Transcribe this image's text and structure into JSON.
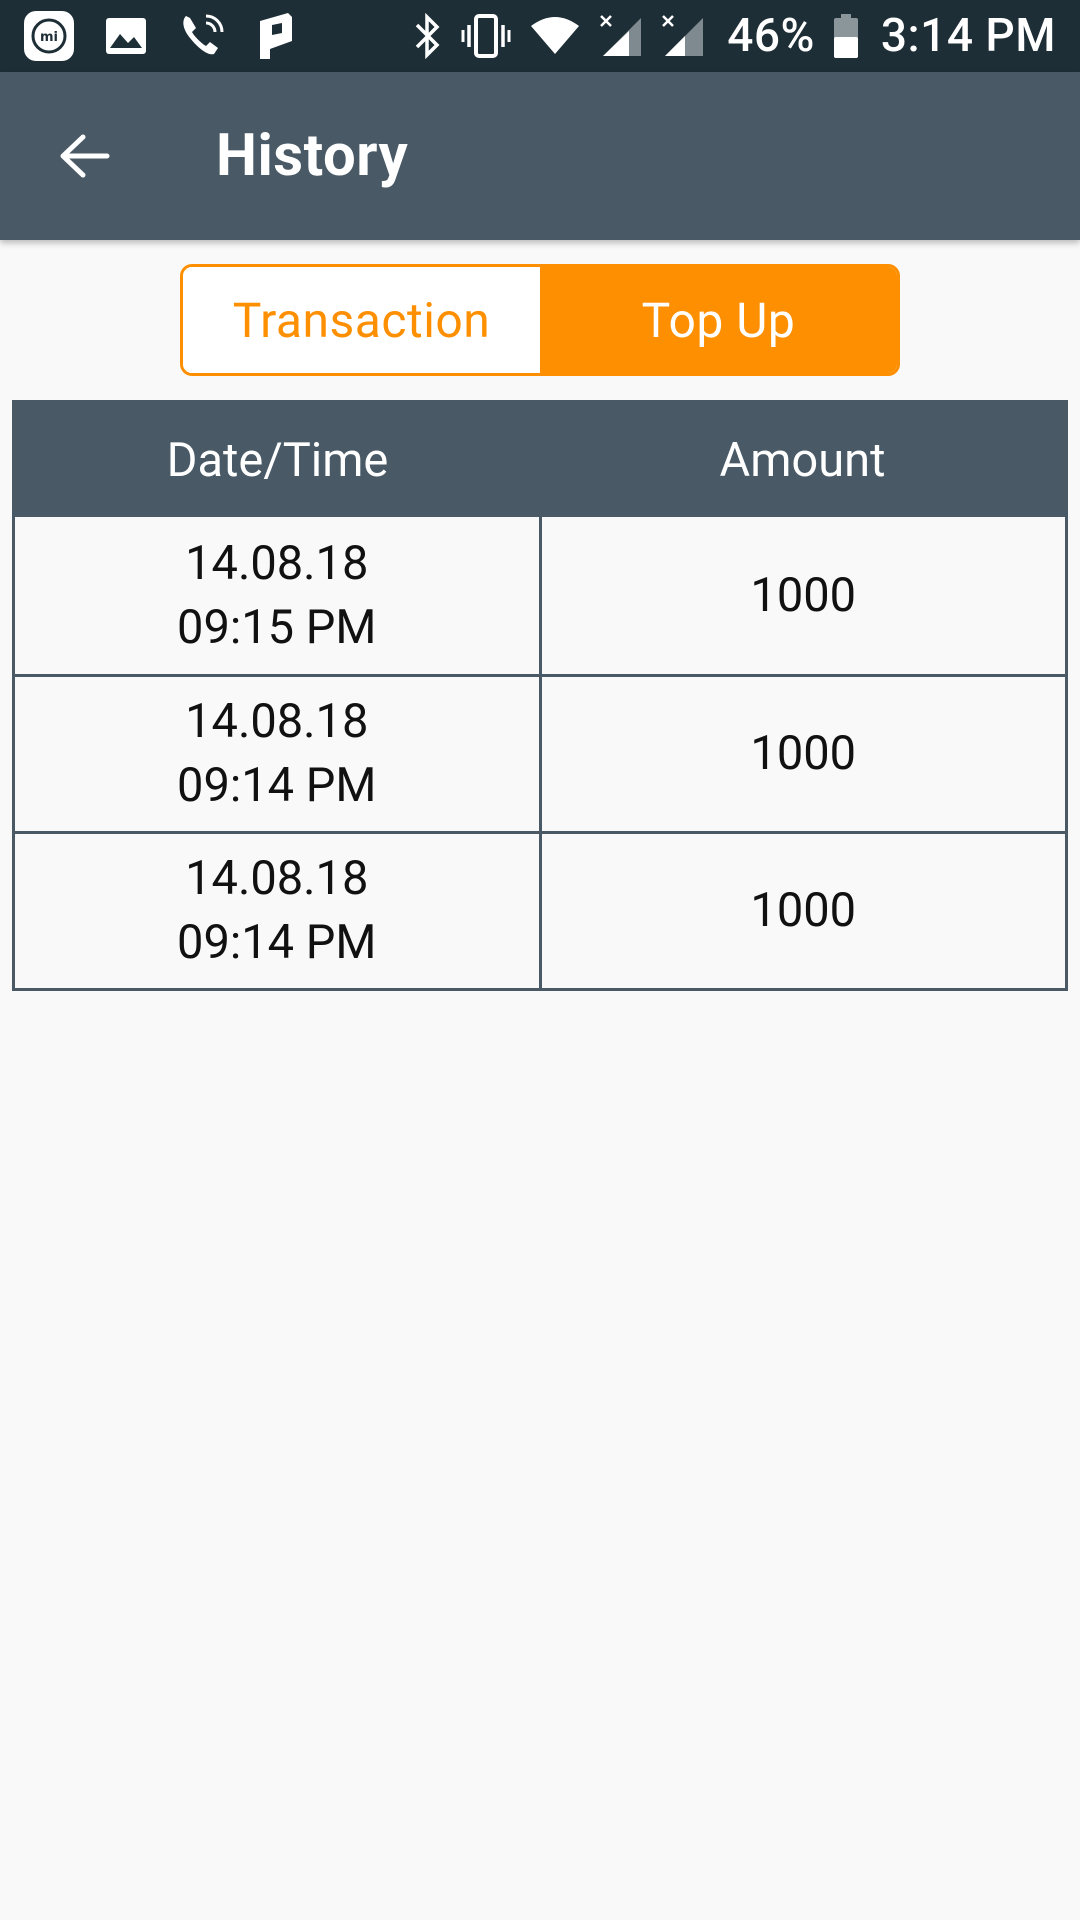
{
  "status_bar": {
    "battery": "46%",
    "time": "3:14 PM",
    "left_icons": [
      "mi-icon",
      "gallery-icon",
      "wifi-calling-icon",
      "parking-app-icon"
    ],
    "right_icons": [
      "bluetooth-icon",
      "vibrate-icon",
      "wifi-icon",
      "signal-no-service-icon",
      "signal-no-service-icon",
      "battery-icon"
    ]
  },
  "app_bar": {
    "title": "History",
    "back_icon": "arrow-back-icon"
  },
  "tabs": [
    {
      "label": "Transaction",
      "selected": false
    },
    {
      "label": "Top Up",
      "selected": true
    }
  ],
  "table": {
    "headers": [
      "Date/Time",
      "Amount"
    ],
    "rows": [
      {
        "date": "14.08.18",
        "time": "09:15 PM",
        "amount": "1000"
      },
      {
        "date": "14.08.18",
        "time": "09:14 PM",
        "amount": "1000"
      },
      {
        "date": "14.08.18",
        "time": "09:14 PM",
        "amount": "1000"
      }
    ]
  },
  "colors": {
    "accent": "#fd8f00",
    "app_bar": "#495a66",
    "status_bar": "#1e2e36",
    "background": "#f9f9f9"
  }
}
